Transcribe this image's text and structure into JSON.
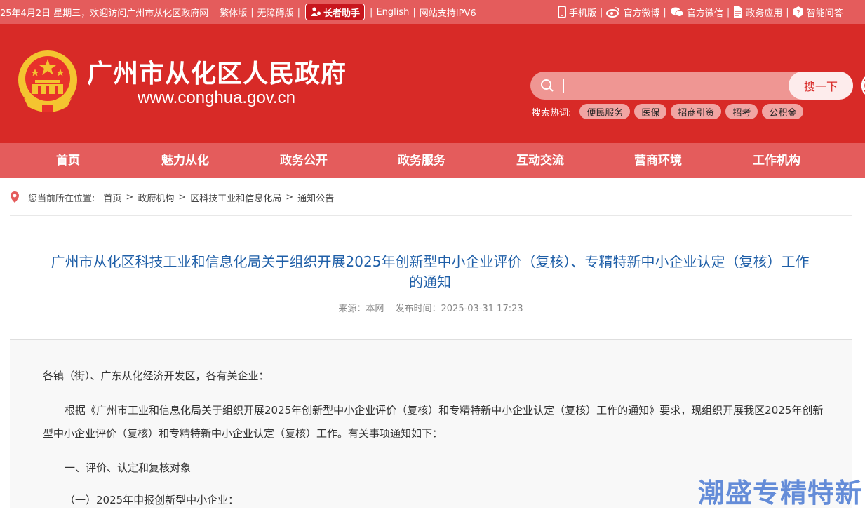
{
  "topbar": {
    "greeting": "25年4月2日 星期三，欢迎访问广州市从化区政府网",
    "traditional": "繁体版",
    "accessible": "无障碍版",
    "elder": "长者助手",
    "english": "English",
    "ipv6": "网站支持IPV6",
    "mobile": "手机版",
    "weibo": "官方微博",
    "wechat": "官方微信",
    "apps": "政务应用",
    "qa": "智能问答"
  },
  "header": {
    "title": "广州市从化区人民政府",
    "url": "www.conghua.gov.cn"
  },
  "search": {
    "placeholder": "",
    "button": "搜一下",
    "hot_label": "搜索热词:",
    "hot_terms": [
      "便民服务",
      "医保",
      "招商引资",
      "招考",
      "公积金"
    ]
  },
  "nav": [
    "首页",
    "魅力从化",
    "政务公开",
    "政务服务",
    "互动交流",
    "营商环境",
    "工作机构"
  ],
  "breadcrumb": {
    "label": "您当前所在位置:",
    "items": [
      "首页",
      "政府机构",
      "区科技工业和信息化局",
      "通知公告"
    ]
  },
  "article": {
    "title_line1": "广州市从化区科技工业和信息化局关于组织开展2025年创新型中小企业评价（复核）、专精特新中小企业认定（复核）工作",
    "title_line2": "的通知",
    "source": "来源：本网",
    "published": "发布时间：2025-03-31 17:23",
    "p1": "各镇（街）、广东从化经济开发区，各有关企业：",
    "p2": "根据《广州市工业和信息化局关于组织开展2025年创新型中小企业评价（复核）和专精特新中小企业认定（复核）工作的通知》要求，现组织开展我区2025年创新型中小企业评价（复核）和专精特新中小企业认定（复核）工作。有关事项通知如下：",
    "p3": "一、评价、认定和复核对象",
    "p4": "（一）2025年申报创新型中小企业："
  },
  "watermark": "潮盛专精特新",
  "colors": {
    "topbar": "#e45c5c",
    "header": "#d82a27",
    "nav": "#e45c5c",
    "title": "#1f5fa8"
  }
}
